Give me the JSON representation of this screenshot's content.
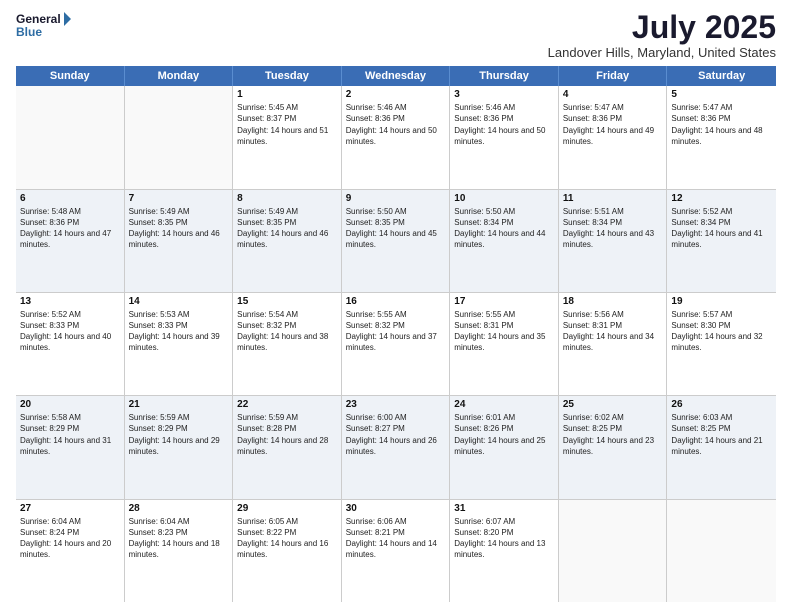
{
  "logo": {
    "line1": "General",
    "line2": "Blue"
  },
  "title": "July 2025",
  "subtitle": "Landover Hills, Maryland, United States",
  "days_of_week": [
    "Sunday",
    "Monday",
    "Tuesday",
    "Wednesday",
    "Thursday",
    "Friday",
    "Saturday"
  ],
  "weeks": [
    [
      {
        "day": "",
        "sunrise": "",
        "sunset": "",
        "daylight": "",
        "empty": true
      },
      {
        "day": "",
        "sunrise": "",
        "sunset": "",
        "daylight": "",
        "empty": true
      },
      {
        "day": "1",
        "sunrise": "Sunrise: 5:45 AM",
        "sunset": "Sunset: 8:37 PM",
        "daylight": "Daylight: 14 hours and 51 minutes.",
        "empty": false
      },
      {
        "day": "2",
        "sunrise": "Sunrise: 5:46 AM",
        "sunset": "Sunset: 8:36 PM",
        "daylight": "Daylight: 14 hours and 50 minutes.",
        "empty": false
      },
      {
        "day": "3",
        "sunrise": "Sunrise: 5:46 AM",
        "sunset": "Sunset: 8:36 PM",
        "daylight": "Daylight: 14 hours and 50 minutes.",
        "empty": false
      },
      {
        "day": "4",
        "sunrise": "Sunrise: 5:47 AM",
        "sunset": "Sunset: 8:36 PM",
        "daylight": "Daylight: 14 hours and 49 minutes.",
        "empty": false
      },
      {
        "day": "5",
        "sunrise": "Sunrise: 5:47 AM",
        "sunset": "Sunset: 8:36 PM",
        "daylight": "Daylight: 14 hours and 48 minutes.",
        "empty": false
      }
    ],
    [
      {
        "day": "6",
        "sunrise": "Sunrise: 5:48 AM",
        "sunset": "Sunset: 8:36 PM",
        "daylight": "Daylight: 14 hours and 47 minutes.",
        "empty": false
      },
      {
        "day": "7",
        "sunrise": "Sunrise: 5:49 AM",
        "sunset": "Sunset: 8:35 PM",
        "daylight": "Daylight: 14 hours and 46 minutes.",
        "empty": false
      },
      {
        "day": "8",
        "sunrise": "Sunrise: 5:49 AM",
        "sunset": "Sunset: 8:35 PM",
        "daylight": "Daylight: 14 hours and 46 minutes.",
        "empty": false
      },
      {
        "day": "9",
        "sunrise": "Sunrise: 5:50 AM",
        "sunset": "Sunset: 8:35 PM",
        "daylight": "Daylight: 14 hours and 45 minutes.",
        "empty": false
      },
      {
        "day": "10",
        "sunrise": "Sunrise: 5:50 AM",
        "sunset": "Sunset: 8:34 PM",
        "daylight": "Daylight: 14 hours and 44 minutes.",
        "empty": false
      },
      {
        "day": "11",
        "sunrise": "Sunrise: 5:51 AM",
        "sunset": "Sunset: 8:34 PM",
        "daylight": "Daylight: 14 hours and 43 minutes.",
        "empty": false
      },
      {
        "day": "12",
        "sunrise": "Sunrise: 5:52 AM",
        "sunset": "Sunset: 8:34 PM",
        "daylight": "Daylight: 14 hours and 41 minutes.",
        "empty": false
      }
    ],
    [
      {
        "day": "13",
        "sunrise": "Sunrise: 5:52 AM",
        "sunset": "Sunset: 8:33 PM",
        "daylight": "Daylight: 14 hours and 40 minutes.",
        "empty": false
      },
      {
        "day": "14",
        "sunrise": "Sunrise: 5:53 AM",
        "sunset": "Sunset: 8:33 PM",
        "daylight": "Daylight: 14 hours and 39 minutes.",
        "empty": false
      },
      {
        "day": "15",
        "sunrise": "Sunrise: 5:54 AM",
        "sunset": "Sunset: 8:32 PM",
        "daylight": "Daylight: 14 hours and 38 minutes.",
        "empty": false
      },
      {
        "day": "16",
        "sunrise": "Sunrise: 5:55 AM",
        "sunset": "Sunset: 8:32 PM",
        "daylight": "Daylight: 14 hours and 37 minutes.",
        "empty": false
      },
      {
        "day": "17",
        "sunrise": "Sunrise: 5:55 AM",
        "sunset": "Sunset: 8:31 PM",
        "daylight": "Daylight: 14 hours and 35 minutes.",
        "empty": false
      },
      {
        "day": "18",
        "sunrise": "Sunrise: 5:56 AM",
        "sunset": "Sunset: 8:31 PM",
        "daylight": "Daylight: 14 hours and 34 minutes.",
        "empty": false
      },
      {
        "day": "19",
        "sunrise": "Sunrise: 5:57 AM",
        "sunset": "Sunset: 8:30 PM",
        "daylight": "Daylight: 14 hours and 32 minutes.",
        "empty": false
      }
    ],
    [
      {
        "day": "20",
        "sunrise": "Sunrise: 5:58 AM",
        "sunset": "Sunset: 8:29 PM",
        "daylight": "Daylight: 14 hours and 31 minutes.",
        "empty": false
      },
      {
        "day": "21",
        "sunrise": "Sunrise: 5:59 AM",
        "sunset": "Sunset: 8:29 PM",
        "daylight": "Daylight: 14 hours and 29 minutes.",
        "empty": false
      },
      {
        "day": "22",
        "sunrise": "Sunrise: 5:59 AM",
        "sunset": "Sunset: 8:28 PM",
        "daylight": "Daylight: 14 hours and 28 minutes.",
        "empty": false
      },
      {
        "day": "23",
        "sunrise": "Sunrise: 6:00 AM",
        "sunset": "Sunset: 8:27 PM",
        "daylight": "Daylight: 14 hours and 26 minutes.",
        "empty": false
      },
      {
        "day": "24",
        "sunrise": "Sunrise: 6:01 AM",
        "sunset": "Sunset: 8:26 PM",
        "daylight": "Daylight: 14 hours and 25 minutes.",
        "empty": false
      },
      {
        "day": "25",
        "sunrise": "Sunrise: 6:02 AM",
        "sunset": "Sunset: 8:25 PM",
        "daylight": "Daylight: 14 hours and 23 minutes.",
        "empty": false
      },
      {
        "day": "26",
        "sunrise": "Sunrise: 6:03 AM",
        "sunset": "Sunset: 8:25 PM",
        "daylight": "Daylight: 14 hours and 21 minutes.",
        "empty": false
      }
    ],
    [
      {
        "day": "27",
        "sunrise": "Sunrise: 6:04 AM",
        "sunset": "Sunset: 8:24 PM",
        "daylight": "Daylight: 14 hours and 20 minutes.",
        "empty": false
      },
      {
        "day": "28",
        "sunrise": "Sunrise: 6:04 AM",
        "sunset": "Sunset: 8:23 PM",
        "daylight": "Daylight: 14 hours and 18 minutes.",
        "empty": false
      },
      {
        "day": "29",
        "sunrise": "Sunrise: 6:05 AM",
        "sunset": "Sunset: 8:22 PM",
        "daylight": "Daylight: 14 hours and 16 minutes.",
        "empty": false
      },
      {
        "day": "30",
        "sunrise": "Sunrise: 6:06 AM",
        "sunset": "Sunset: 8:21 PM",
        "daylight": "Daylight: 14 hours and 14 minutes.",
        "empty": false
      },
      {
        "day": "31",
        "sunrise": "Sunrise: 6:07 AM",
        "sunset": "Sunset: 8:20 PM",
        "daylight": "Daylight: 14 hours and 13 minutes.",
        "empty": false
      },
      {
        "day": "",
        "sunrise": "",
        "sunset": "",
        "daylight": "",
        "empty": true
      },
      {
        "day": "",
        "sunrise": "",
        "sunset": "",
        "daylight": "",
        "empty": true
      }
    ]
  ]
}
